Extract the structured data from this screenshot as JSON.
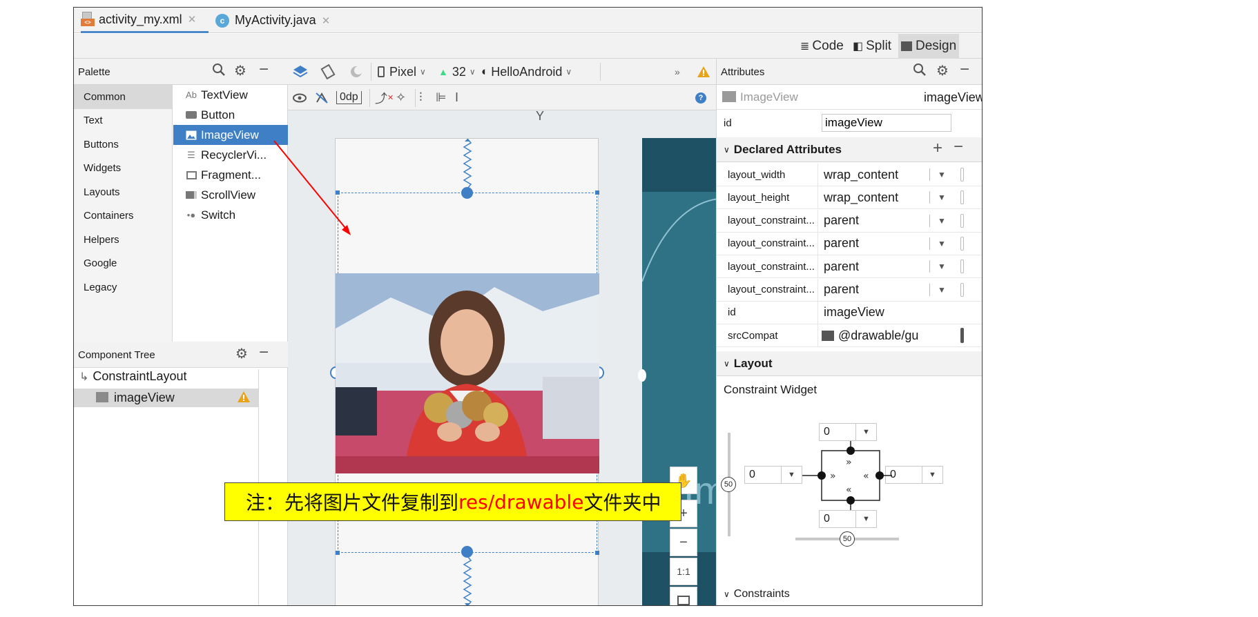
{
  "tabs": [
    {
      "label": "activity_my.xml",
      "icon": "xml-file-icon",
      "active": true
    },
    {
      "label": "MyActivity.java",
      "icon": "java-class-icon",
      "active": false
    }
  ],
  "view_modes": {
    "code": "Code",
    "split": "Split",
    "design": "Design"
  },
  "palette": {
    "title": "Palette",
    "categories": [
      "Common",
      "Text",
      "Buttons",
      "Widgets",
      "Layouts",
      "Containers",
      "Helpers",
      "Google",
      "Legacy"
    ],
    "selected_category": "Common",
    "items": [
      {
        "label": "TextView",
        "icon": "Ab"
      },
      {
        "label": "Button",
        "icon": "button-icon"
      },
      {
        "label": "ImageView",
        "icon": "image-icon"
      },
      {
        "label": "RecyclerVi...",
        "icon": "list-icon"
      },
      {
        "label": "Fragment...",
        "icon": "fragment-icon"
      },
      {
        "label": "ScrollView",
        "icon": "scroll-icon"
      },
      {
        "label": "Switch",
        "icon": "switch-icon"
      }
    ],
    "selected_item": "ImageView"
  },
  "component_tree": {
    "title": "Component Tree",
    "root": "ConstraintLayout",
    "child": "imageView"
  },
  "design_toolbar": {
    "device": "Pixel",
    "api": "32",
    "theme": "HelloAndroid",
    "margin": "0dp"
  },
  "zoom_controls": {
    "one_to_one": "1:1"
  },
  "canvas_text": "Im",
  "attributes": {
    "title": "Attributes",
    "component_type": "ImageView",
    "component_id": "imageView",
    "id_label": "id",
    "id_value": "imageView",
    "declared_section": "Declared Attributes",
    "rows": [
      {
        "name": "layout_width",
        "value": "wrap_content"
      },
      {
        "name": "layout_height",
        "value": "wrap_content"
      },
      {
        "name": "layout_constraint...",
        "value": "parent"
      },
      {
        "name": "layout_constraint...",
        "value": "parent"
      },
      {
        "name": "layout_constraint...",
        "value": "parent"
      },
      {
        "name": "layout_constraint...",
        "value": "parent"
      },
      {
        "name": "id",
        "value": "imageView"
      },
      {
        "name": "srcCompat",
        "value": "@drawable/gu"
      }
    ],
    "layout_section": "Layout",
    "constraint_widget": "Constraint Widget",
    "margins": {
      "top": "0",
      "left": "0",
      "right": "0",
      "bottom": "0"
    },
    "bias_vertical": "50",
    "bias_horizontal": "50",
    "constraints_section": "Constraints"
  },
  "annotation": {
    "prefix": "注：先将图片文件复制到",
    "highlight": "res/drawable",
    "suffix": "文件夹中",
    "highlight_color": "#ff0000",
    "background_color": "#ffff00"
  },
  "colors": {
    "accent": "#3e7fc6",
    "warning": "#e8a317",
    "arrow": "#ff0000"
  }
}
